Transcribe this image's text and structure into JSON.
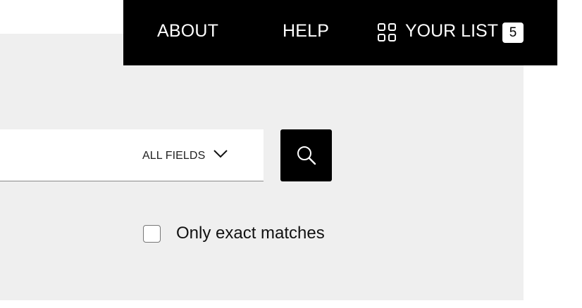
{
  "nav": {
    "about": "ABOUT",
    "help": "HELP",
    "your_list": "YOUR LIST",
    "list_count": "5",
    "list_icon": "grid-icon"
  },
  "search": {
    "input_value": "",
    "field_selector": "ALL FIELDS",
    "dropdown_icon": "chevron-down-icon",
    "button_icon": "search-icon"
  },
  "filters": {
    "exact_matches_label": "Only exact matches",
    "exact_matches_checked": false
  },
  "colors": {
    "nav_background": "#000000",
    "panel_background": "#efefef",
    "text": "#111111"
  }
}
